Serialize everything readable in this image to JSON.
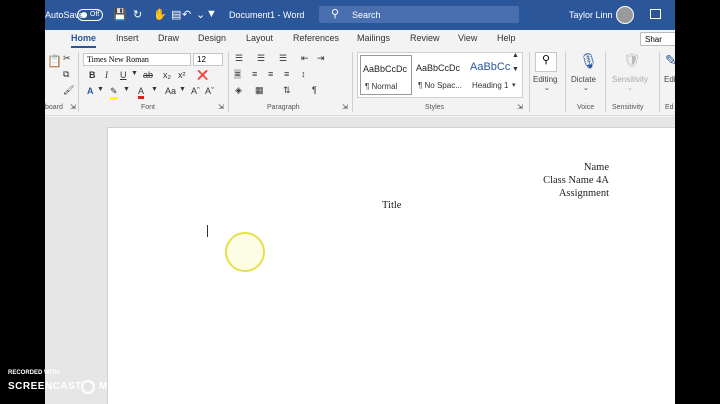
{
  "titlebar": {
    "autosave_label": "AutoSave",
    "autosave_state": "Off",
    "doc_title": "Document1 - Word",
    "search_placeholder": "Search",
    "user_name": "Taylor Linn"
  },
  "tabs": [
    "Home",
    "Insert",
    "Draw",
    "Design",
    "Layout",
    "References",
    "Mailings",
    "Review",
    "View",
    "Help"
  ],
  "share_label": "Shar",
  "ribbon": {
    "font_name": "Times New Roman",
    "font_size": "12",
    "groups": {
      "clipboard": "board",
      "font": "Font",
      "paragraph": "Paragraph",
      "styles": "Styles",
      "voice": "Voice",
      "sensitivity": "Sensitivity",
      "editing_cut": "Ed"
    },
    "styles": [
      {
        "sample": "AaBbCcDc",
        "name": "¶ Normal"
      },
      {
        "sample": "AaBbCcDc",
        "name": "¶ No Spac..."
      },
      {
        "sample": "AaBbCc",
        "name": "Heading 1"
      }
    ],
    "editing_label": "Editing",
    "dictate_label": "Dictate",
    "sensitivity_label": "Sensitivity",
    "editor_label": "Edi"
  },
  "document": {
    "header_lines": [
      "Name",
      "Class Name 4A",
      "Assignment"
    ],
    "title": "Title"
  },
  "watermark": {
    "line1": "RECORDED WITH",
    "line2": "SCREENCAST",
    "line3": "MATIC"
  }
}
